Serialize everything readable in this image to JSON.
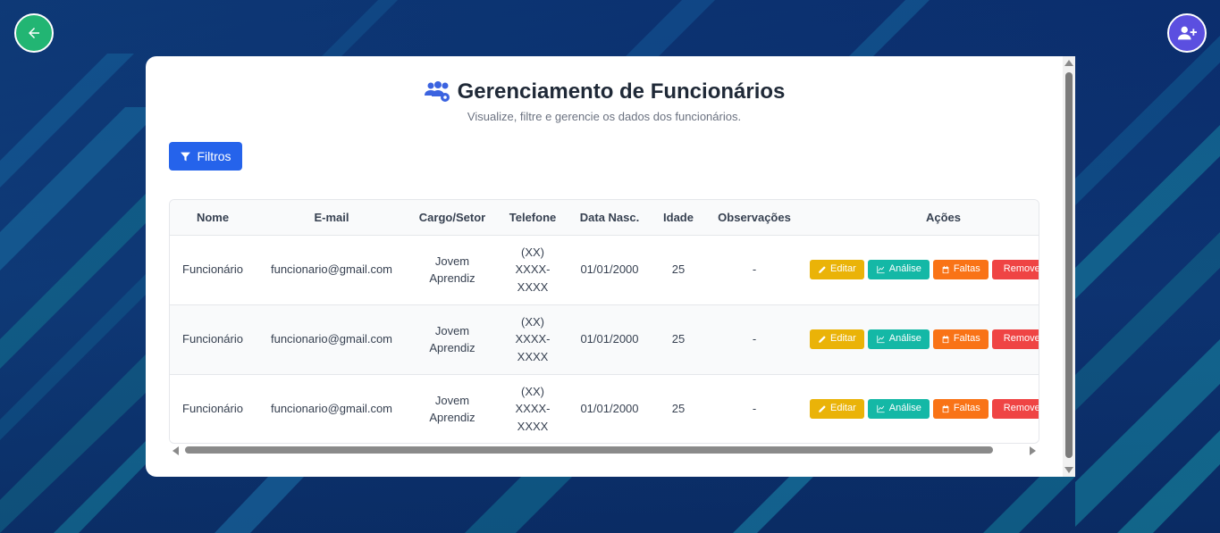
{
  "nav": {
    "back_icon": "arrow-left-icon",
    "add_icon": "user-plus-icon",
    "back_color": "#22b573",
    "add_color": "#5b4fe0"
  },
  "header": {
    "icon": "users-cog-icon",
    "title": "Gerenciamento de Funcionários",
    "subtitle": "Visualize, filtre e gerencie os dados dos funcionários."
  },
  "filter": {
    "label": "Filtros",
    "icon": "filter-icon"
  },
  "table": {
    "columns": [
      "Nome",
      "E-mail",
      "Cargo/Setor",
      "Telefone",
      "Data Nasc.",
      "Idade",
      "Observações",
      "Ações"
    ],
    "rows": [
      {
        "nome": "Funcionário",
        "email": "funcionario@gmail.com",
        "cargo": "Jovem Aprendiz",
        "telefone": "(XX) XXXX-XXXX",
        "nasc": "01/01/2000",
        "idade": "25",
        "obs": "-"
      },
      {
        "nome": "Funcionário",
        "email": "funcionario@gmail.com",
        "cargo": "Jovem Aprendiz",
        "telefone": "(XX) XXXX-XXXX",
        "nasc": "01/01/2000",
        "idade": "25",
        "obs": "-"
      },
      {
        "nome": "Funcionário",
        "email": "funcionario@gmail.com",
        "cargo": "Jovem Aprendiz",
        "telefone": "(XX) XXXX-XXXX",
        "nasc": "01/01/2000",
        "idade": "25",
        "obs": "-"
      }
    ],
    "actions": {
      "edit": "Editar",
      "analysis": "Análise",
      "absences": "Faltas",
      "remove": "Remover"
    }
  },
  "colors": {
    "primary": "#2563eb",
    "edit": "#eab308",
    "analysis": "#14b8a6",
    "absences": "#f97316",
    "remove": "#ef4444"
  }
}
